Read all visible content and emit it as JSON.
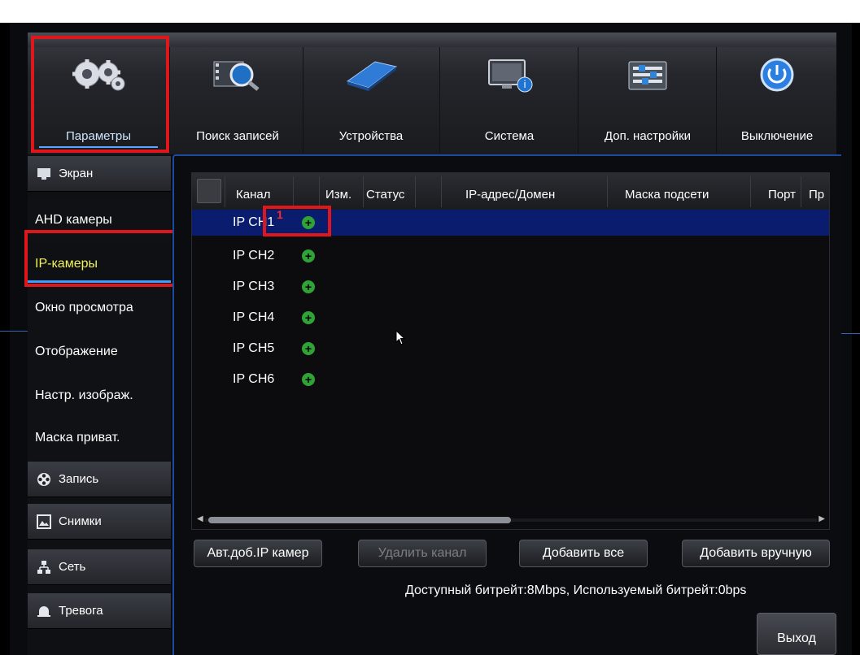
{
  "top_menu": {
    "tabs": [
      {
        "label": "Параметры",
        "icon": "gears-icon",
        "active": true
      },
      {
        "label": "Поиск записей",
        "icon": "film-search-icon"
      },
      {
        "label": "Устройства",
        "icon": "hard-drive-icon"
      },
      {
        "label": "Система",
        "icon": "monitor-info-icon"
      },
      {
        "label": "Доп. настройки",
        "icon": "sliders-icon"
      },
      {
        "label": "Выключение",
        "icon": "power-icon"
      }
    ]
  },
  "sidebar": {
    "sections": [
      {
        "label": "Экран",
        "icon": "monitor-icon"
      },
      {
        "label": "Запись",
        "icon": "film-reel-icon"
      },
      {
        "label": "Снимки",
        "icon": "snapshot-icon"
      },
      {
        "label": "Сеть",
        "icon": "network-icon"
      },
      {
        "label": "Тревога",
        "icon": "alarm-bell-icon"
      }
    ],
    "items": [
      {
        "label": "AHD камеры"
      },
      {
        "label": "IP-камеры",
        "selected": true
      },
      {
        "label": "Окно просмотра"
      },
      {
        "label": "Отображение"
      },
      {
        "label": "Настр. изображ."
      },
      {
        "label": "Маска приват."
      }
    ]
  },
  "table": {
    "columns": [
      "Канал",
      "Изм.",
      "Статус",
      "IP-адрес/Домен",
      "Маска подсети",
      "Порт",
      "Пр"
    ],
    "rows": [
      {
        "channel": "IP CH1",
        "selected": true
      },
      {
        "channel": "IP CH2"
      },
      {
        "channel": "IP CH3"
      },
      {
        "channel": "IP CH4"
      },
      {
        "channel": "IP CH5"
      },
      {
        "channel": "IP CH6"
      }
    ],
    "add_symbol": "+",
    "annotation_marker": "1"
  },
  "buttons": {
    "auto_add": "Авт.доб.IP камер",
    "delete": "Удалить канал",
    "add_all": "Добавить все",
    "add_manual": "Добавить вручную",
    "exit": "Выход"
  },
  "status": "Доступный битрейт:8Mbps, Используемый битрейт:0bps",
  "colors": {
    "highlight_box": "#e0161d",
    "selected_row": "#0a1c6e",
    "selected_item_text": "#f2f25a",
    "add_icon": "#2fa335"
  }
}
